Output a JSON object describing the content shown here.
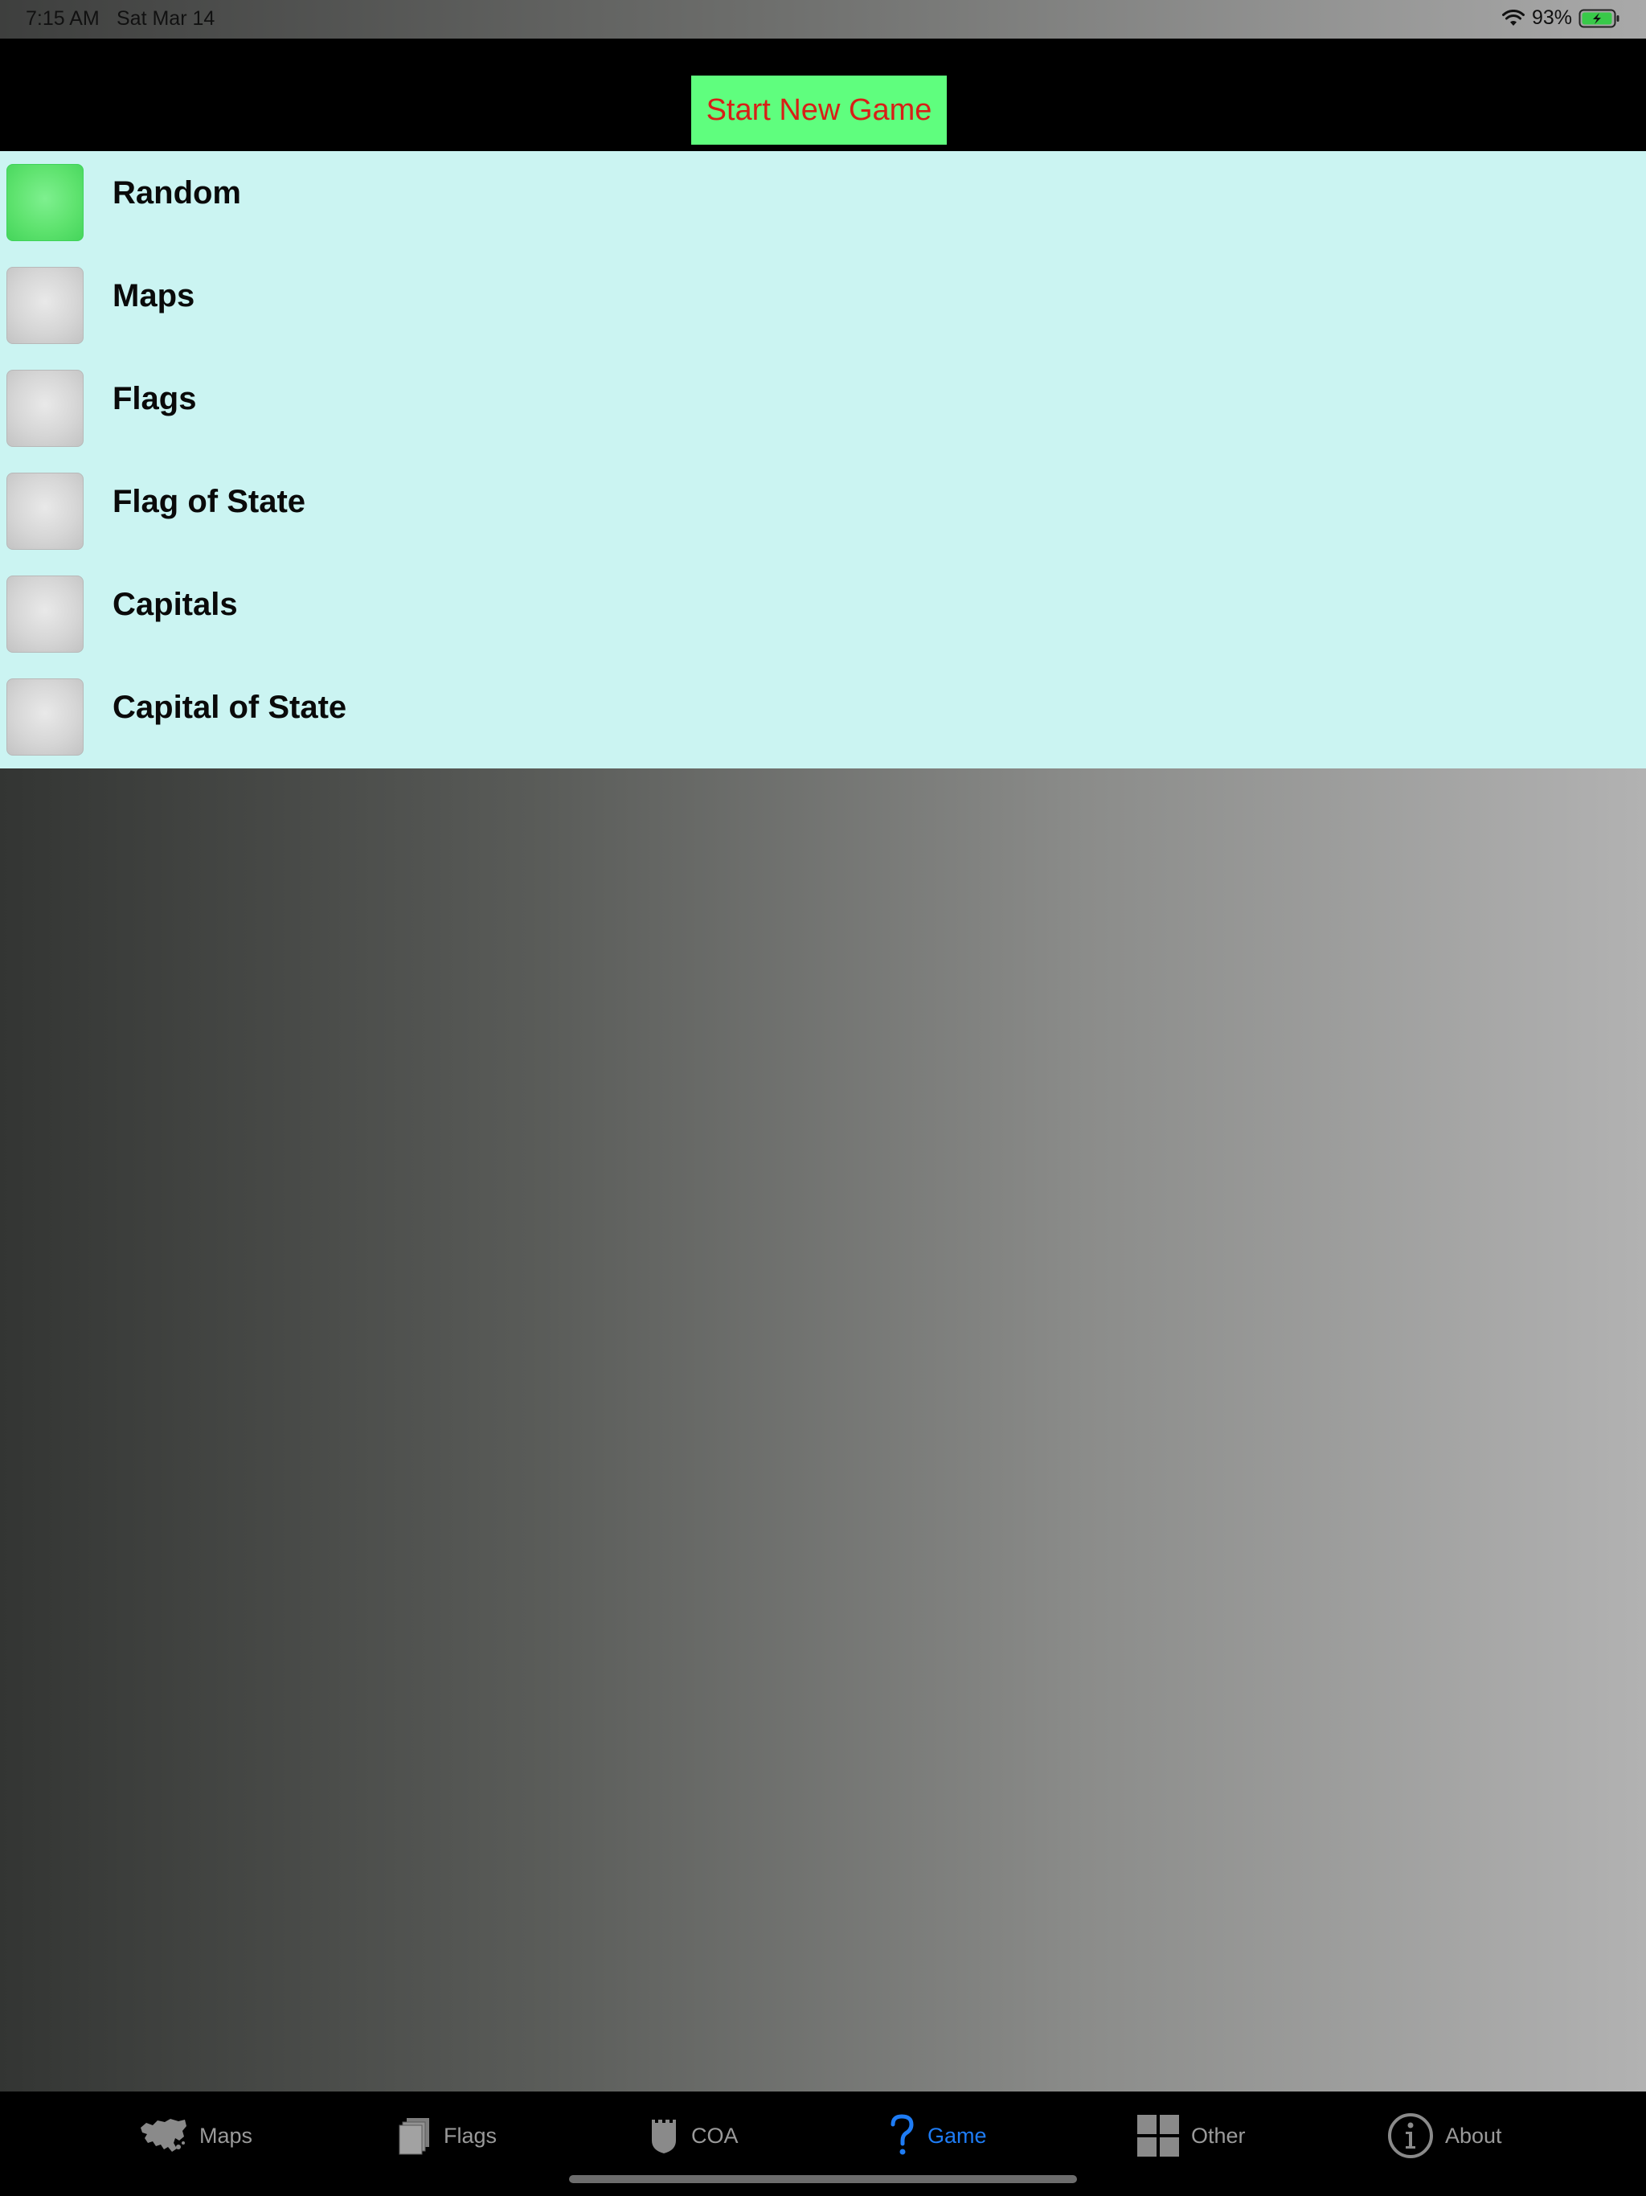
{
  "status_bar": {
    "time": "7:15 AM",
    "date": "Sat Mar 14",
    "battery": "93%"
  },
  "header": {
    "start_button": "Start New Game"
  },
  "options": [
    {
      "label": "Random",
      "selected": true
    },
    {
      "label": "Maps",
      "selected": false
    },
    {
      "label": "Flags",
      "selected": false
    },
    {
      "label": "Flag of State",
      "selected": false
    },
    {
      "label": "Capitals",
      "selected": false
    },
    {
      "label": "Capital of State",
      "selected": false
    }
  ],
  "tabs": [
    {
      "label": "Maps",
      "icon": "map-icon",
      "active": false
    },
    {
      "label": "Flags",
      "icon": "flag-book-icon",
      "active": false
    },
    {
      "label": "COA",
      "icon": "shield-icon",
      "active": false
    },
    {
      "label": "Game",
      "icon": "question-icon",
      "active": true
    },
    {
      "label": "Other",
      "icon": "grid-icon",
      "active": false
    },
    {
      "label": "About",
      "icon": "info-icon",
      "active": false
    }
  ],
  "colors": {
    "accent": "#1e7cf5",
    "button_bg": "#5ffe7e",
    "button_text": "#d81f17",
    "list_bg": "#cbf4f2",
    "selected_box": "#5fe36f"
  }
}
